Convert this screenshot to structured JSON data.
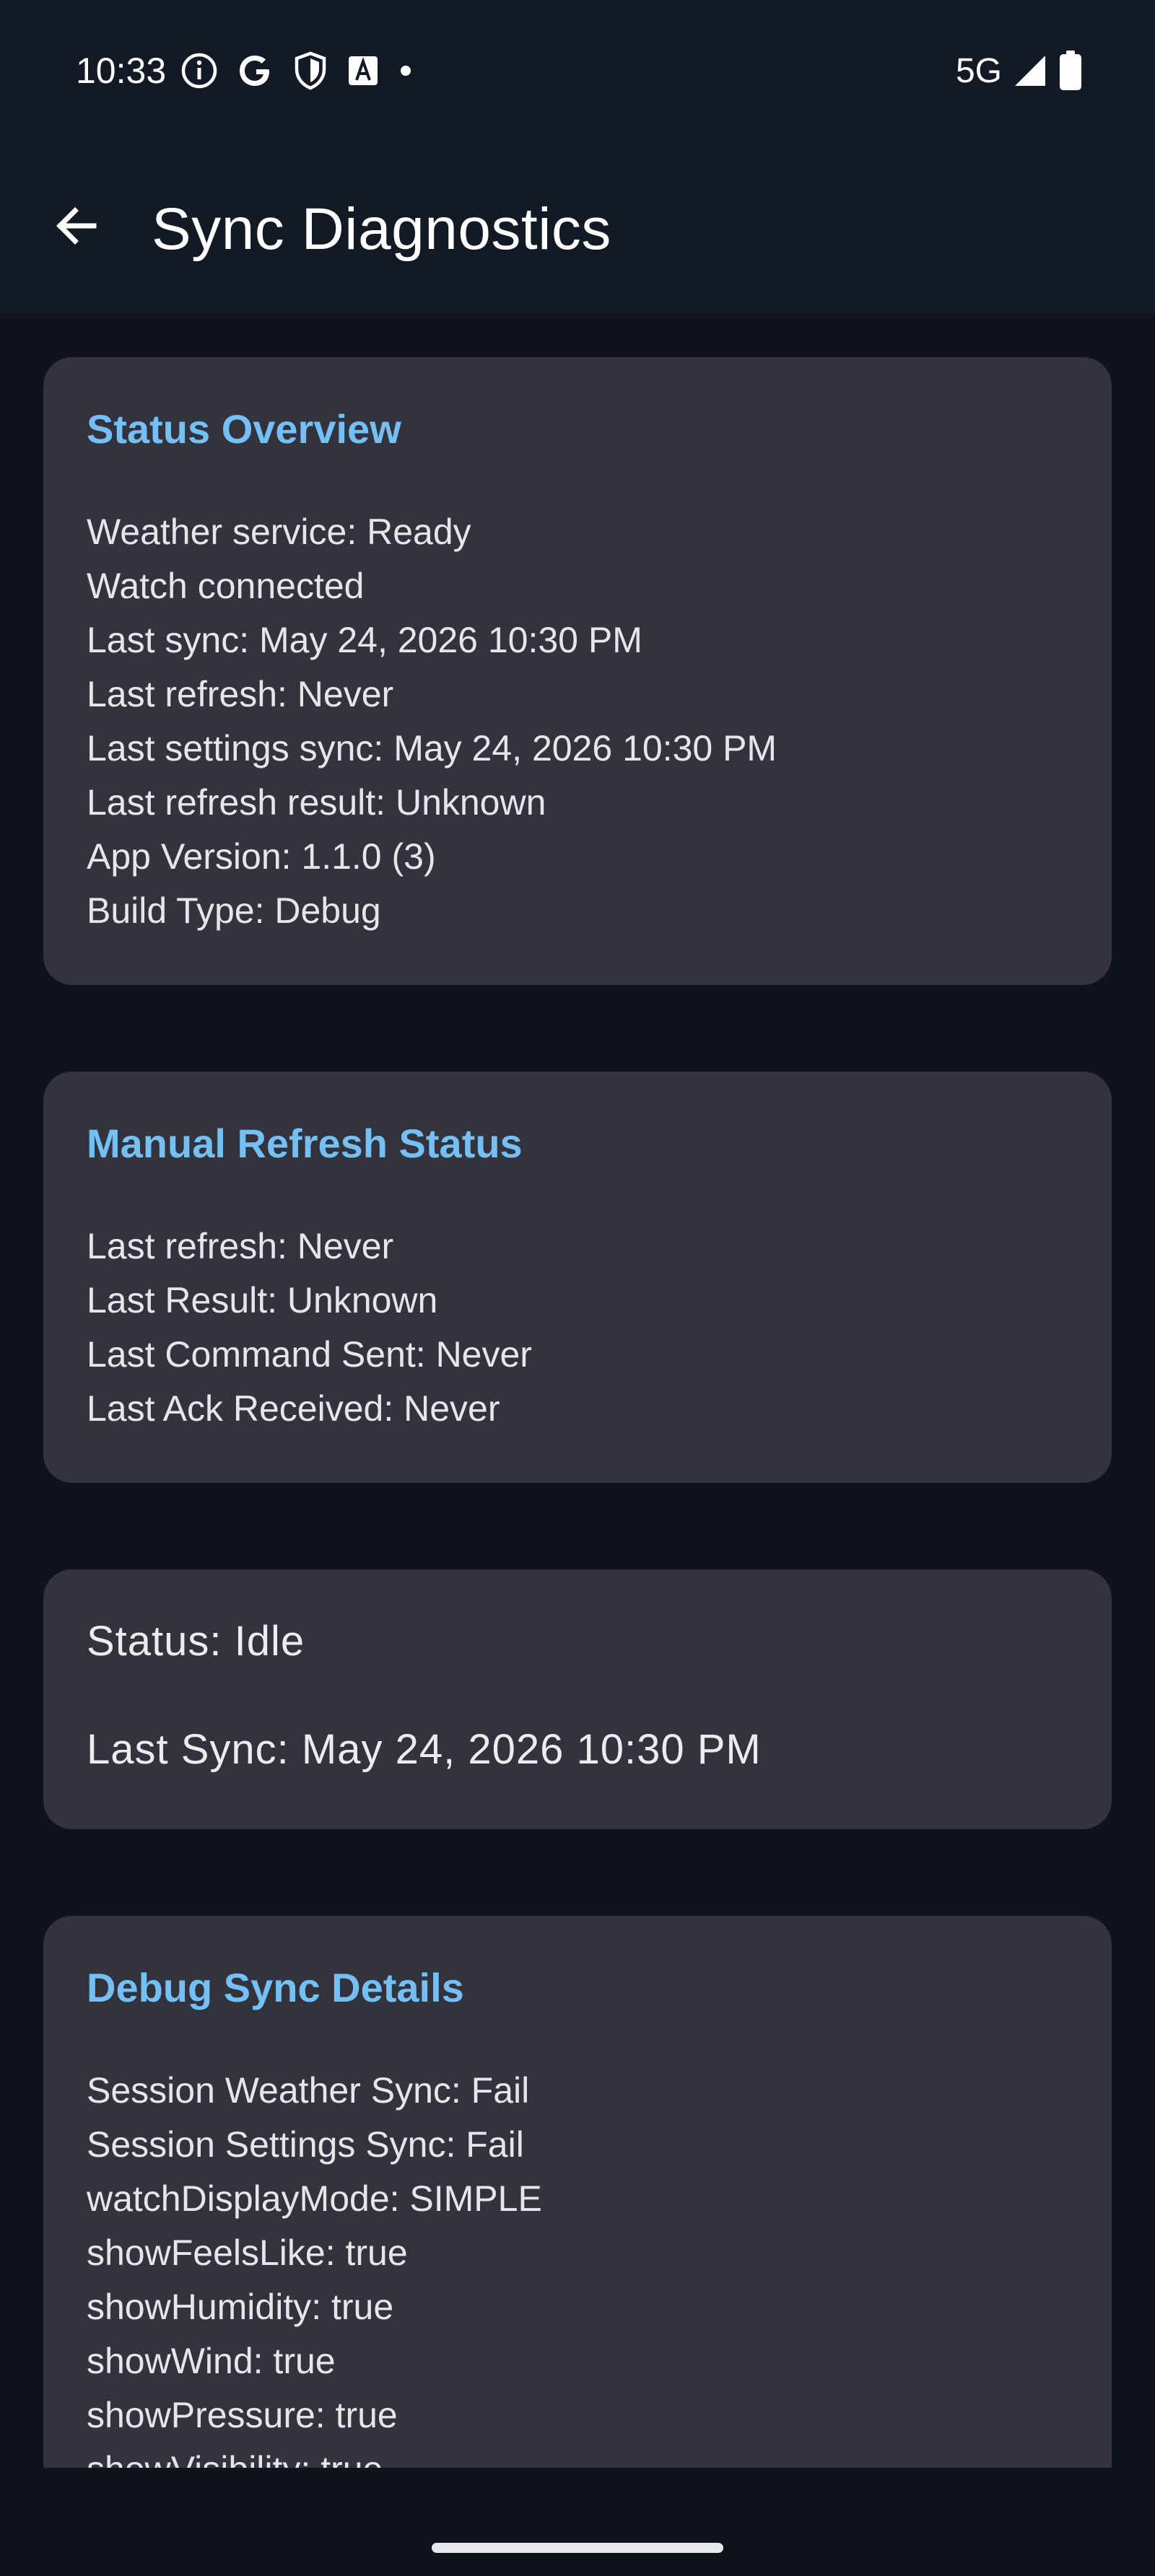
{
  "status_bar": {
    "time": "10:33",
    "left_icons": [
      "info-icon",
      "google-icon",
      "shield-icon",
      "translate-icon",
      "dot-icon"
    ],
    "network": "5G",
    "right_icons": [
      "signal-icon",
      "battery-icon"
    ]
  },
  "app_bar": {
    "title": "Sync Diagnostics",
    "back_icon": "arrow-back-icon"
  },
  "cards": {
    "overview": {
      "title": "Status Overview",
      "lines": [
        "Weather service: Ready",
        "Watch connected",
        "Last sync: May 24, 2026 10:30 PM",
        "Last refresh: Never",
        "Last settings sync: May 24, 2026 10:30 PM",
        "Last refresh result: Unknown",
        "App Version: 1.1.0 (3)",
        "Build Type: Debug"
      ]
    },
    "manual": {
      "title": "Manual Refresh Status",
      "lines": [
        "Last refresh: Never",
        "Last Result: Unknown",
        "Last Command Sent: Never",
        "Last Ack Received: Never"
      ]
    },
    "status": {
      "status_text": "Status: Idle",
      "last_sync_text": "Last Sync: May 24, 2026 10:30 PM"
    },
    "debug": {
      "title": "Debug Sync Details",
      "lines": [
        "Session Weather Sync: Fail",
        "Session Settings Sync: Fail",
        "watchDisplayMode: SIMPLE",
        "showFeelsLike: true",
        "showHumidity: true",
        "showWind: true",
        "showPressure: true",
        "showVisibility: true"
      ]
    }
  },
  "colors": {
    "background": "#0f131c",
    "bar_background": "#131925",
    "card_background": "#33333d",
    "card_title": "#74c0f5",
    "text": "#e6e6ea"
  }
}
